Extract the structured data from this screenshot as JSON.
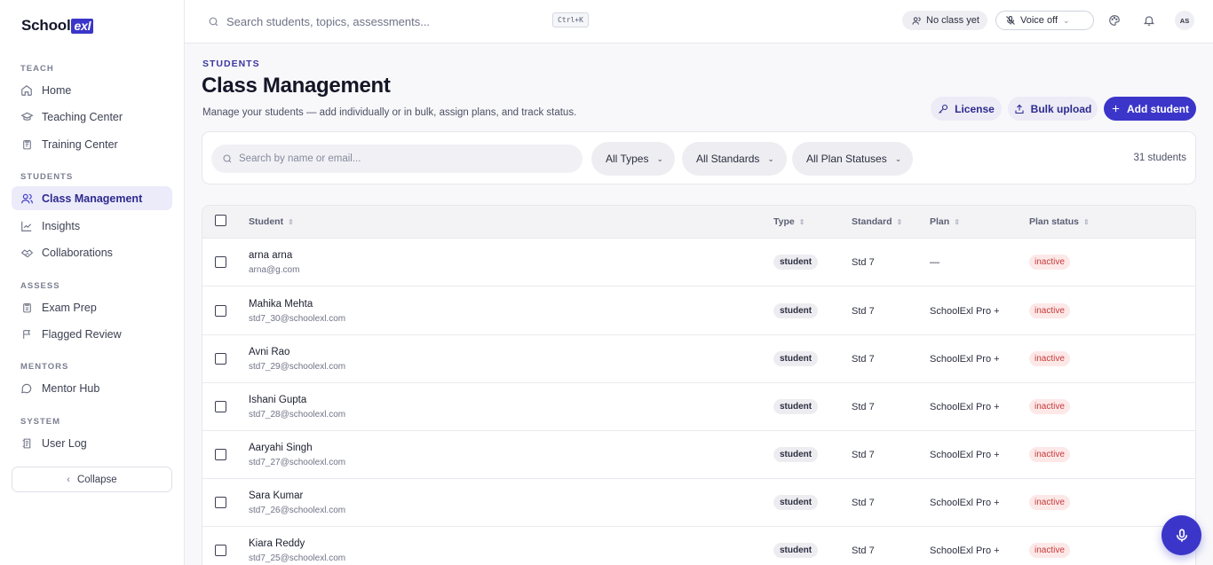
{
  "brand": {
    "name": "School",
    "mark": "exl"
  },
  "sidebar": {
    "sections": [
      {
        "label": "TEACH",
        "items": [
          {
            "label": "Home",
            "icon": "home-icon"
          },
          {
            "label": "Teaching Center",
            "icon": "graduation-cap-icon"
          },
          {
            "label": "Training Center",
            "icon": "clipboard-icon"
          }
        ]
      },
      {
        "label": "STUDENTS",
        "items": [
          {
            "label": "Class Management",
            "icon": "users-icon",
            "active": true
          },
          {
            "label": "Insights",
            "icon": "line-chart-icon"
          },
          {
            "label": "Collaborations",
            "icon": "handshake-icon"
          }
        ]
      },
      {
        "label": "ASSESS",
        "items": [
          {
            "label": "Exam Prep",
            "icon": "clipboard-list-icon"
          },
          {
            "label": "Flagged Review",
            "icon": "flag-icon"
          }
        ]
      },
      {
        "label": "MENTORS",
        "items": [
          {
            "label": "Mentor Hub",
            "icon": "chat-bubble-icon"
          }
        ]
      },
      {
        "label": "SYSTEM",
        "items": [
          {
            "label": "User Log",
            "icon": "log-icon"
          }
        ]
      }
    ],
    "collapse_label": "Collapse"
  },
  "topbar": {
    "search_placeholder": "Search students, topics, assessments...",
    "shortcut": "Ctrl+K",
    "class_pill": "No class yet",
    "voice_pill": "Voice off",
    "avatar_initials": "AS"
  },
  "header": {
    "eyebrow": "STUDENTS",
    "title": "Class Management",
    "subtitle": "Manage your students — add individually or in bulk, assign plans, and track status.",
    "license_label": "License",
    "bulk_label": "Bulk upload",
    "add_label": "Add student"
  },
  "filters": {
    "search_placeholder": "Search by name or email...",
    "types": "All Types",
    "standards": "All Standards",
    "plan_statuses": "All Plan Statuses",
    "count": "31 students"
  },
  "table": {
    "columns": [
      "Student",
      "Type",
      "Standard",
      "Plan",
      "Plan status"
    ],
    "rows": [
      {
        "name": "arna arna",
        "email": "arna@g.com",
        "type": "student",
        "standard": "Std 7",
        "plan": "—",
        "status": "inactive"
      },
      {
        "name": "Mahika Mehta",
        "email": "std7_30@schoolexl.com",
        "type": "student",
        "standard": "Std 7",
        "plan": "SchoolExl Pro +",
        "status": "inactive"
      },
      {
        "name": "Avni Rao",
        "email": "std7_29@schoolexl.com",
        "type": "student",
        "standard": "Std 7",
        "plan": "SchoolExl Pro +",
        "status": "inactive"
      },
      {
        "name": "Ishani Gupta",
        "email": "std7_28@schoolexl.com",
        "type": "student",
        "standard": "Std 7",
        "plan": "SchoolExl Pro +",
        "status": "inactive"
      },
      {
        "name": "Aaryahi Singh",
        "email": "std7_27@schoolexl.com",
        "type": "student",
        "standard": "Std 7",
        "plan": "SchoolExl Pro +",
        "status": "inactive"
      },
      {
        "name": "Sara Kumar",
        "email": "std7_26@schoolexl.com",
        "type": "student",
        "standard": "Std 7",
        "plan": "SchoolExl Pro +",
        "status": "inactive"
      },
      {
        "name": "Kiara Reddy",
        "email": "std7_25@schoolexl.com",
        "type": "student",
        "standard": "Std 7",
        "plan": "SchoolExl Pro +",
        "status": "inactive"
      }
    ]
  },
  "colors": {
    "accent": "#3b36c9",
    "inactive_text": "#c63a3a",
    "inactive_bg": "#fde8e8"
  }
}
